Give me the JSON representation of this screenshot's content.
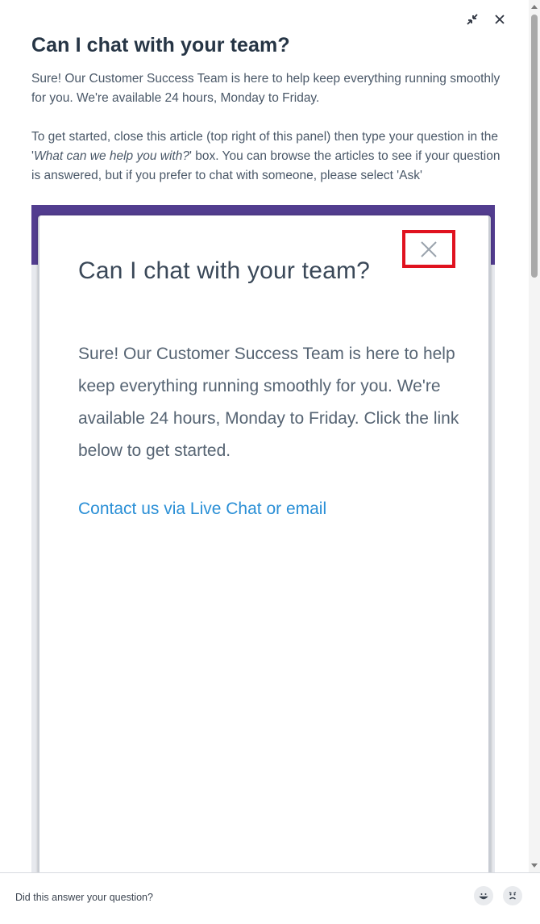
{
  "article": {
    "title": "Can I chat with your team?",
    "paragraph1": "Sure! Our Customer Success Team is here to help keep everything running smoothly for you. We're available 24 hours, Monday to Friday.",
    "paragraph2_before": "To get started, close this article (top right of this panel) then type your question in the '",
    "paragraph2_italic": "What can we help you with?",
    "paragraph2_after": "' box. You can browse the articles to see if your question is answered, but if you prefer to chat with someone, please select 'Ask'"
  },
  "embedded_screenshot": {
    "title": "Can I chat with your team?",
    "body": "Sure! Our Customer Success Team is here to help keep everything running smoothly for you. We're available 24 hours, Monday to Friday. Click the link below to get started.",
    "link": "Contact us via Live Chat or email",
    "accent_color": "#523d8f",
    "highlight_color": "#e0121f"
  },
  "controls": {
    "minimize_icon": "minimize-arrows-icon",
    "close_icon": "close-icon"
  },
  "footer": {
    "question": "Did this answer your question?",
    "positive_icon": "smile-face-icon",
    "negative_icon": "frown-face-icon"
  }
}
